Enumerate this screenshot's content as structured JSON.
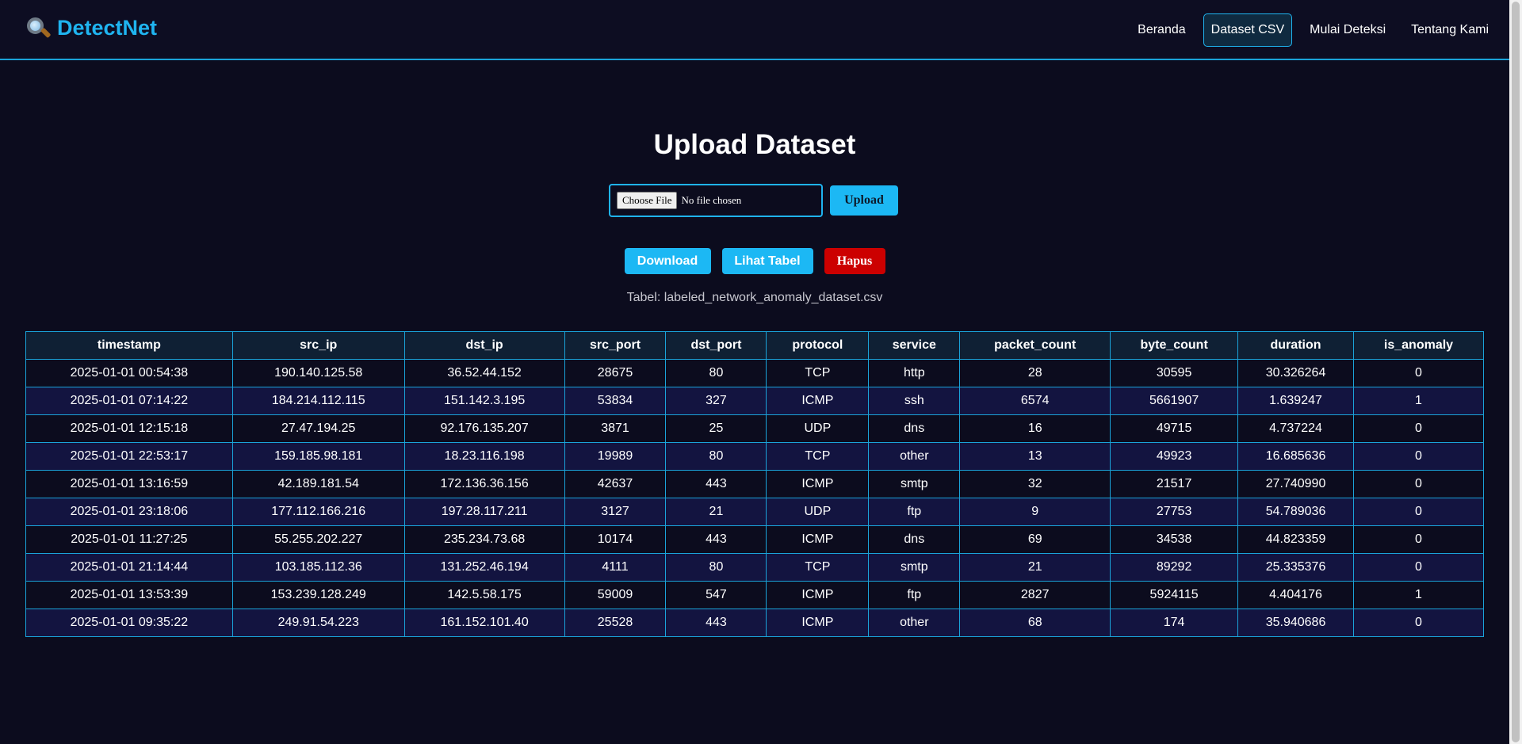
{
  "navbar": {
    "brand": "DetectNet",
    "links": [
      "Beranda",
      "Dataset CSV",
      "Mulai Deteksi",
      "Tentang Kami"
    ],
    "active_index": 1
  },
  "upload": {
    "title": "Upload Dataset",
    "choose_file_label": "Choose File",
    "file_status": "No file chosen",
    "upload_label": "Upload"
  },
  "actions": {
    "download_label": "Download",
    "view_label": "Lihat Tabel",
    "delete_label": "Hapus"
  },
  "caption": "Tabel: labeled_network_anomaly_dataset.csv",
  "table": {
    "columns": [
      "timestamp",
      "src_ip",
      "dst_ip",
      "src_port",
      "dst_port",
      "protocol",
      "service",
      "packet_count",
      "byte_count",
      "duration",
      "is_anomaly"
    ],
    "rows": [
      [
        "2025-01-01 00:54:38",
        "190.140.125.58",
        "36.52.44.152",
        "28675",
        "80",
        "TCP",
        "http",
        "28",
        "30595",
        "30.326264",
        "0"
      ],
      [
        "2025-01-01 07:14:22",
        "184.214.112.115",
        "151.142.3.195",
        "53834",
        "327",
        "ICMP",
        "ssh",
        "6574",
        "5661907",
        "1.639247",
        "1"
      ],
      [
        "2025-01-01 12:15:18",
        "27.47.194.25",
        "92.176.135.207",
        "3871",
        "25",
        "UDP",
        "dns",
        "16",
        "49715",
        "4.737224",
        "0"
      ],
      [
        "2025-01-01 22:53:17",
        "159.185.98.181",
        "18.23.116.198",
        "19989",
        "80",
        "TCP",
        "other",
        "13",
        "49923",
        "16.685636",
        "0"
      ],
      [
        "2025-01-01 13:16:59",
        "42.189.181.54",
        "172.136.36.156",
        "42637",
        "443",
        "ICMP",
        "smtp",
        "32",
        "21517",
        "27.740990",
        "0"
      ],
      [
        "2025-01-01 23:18:06",
        "177.112.166.216",
        "197.28.117.211",
        "3127",
        "21",
        "UDP",
        "ftp",
        "9",
        "27753",
        "54.789036",
        "0"
      ],
      [
        "2025-01-01 11:27:25",
        "55.255.202.227",
        "235.234.73.68",
        "10174",
        "443",
        "ICMP",
        "dns",
        "69",
        "34538",
        "44.823359",
        "0"
      ],
      [
        "2025-01-01 21:14:44",
        "103.185.112.36",
        "131.252.46.194",
        "4111",
        "80",
        "TCP",
        "smtp",
        "21",
        "89292",
        "25.335376",
        "0"
      ],
      [
        "2025-01-01 13:53:39",
        "153.239.128.249",
        "142.5.58.175",
        "59009",
        "547",
        "ICMP",
        "ftp",
        "2827",
        "5924115",
        "4.404176",
        "1"
      ],
      [
        "2025-01-01 09:35:22",
        "249.91.54.223",
        "161.152.101.40",
        "25528",
        "443",
        "ICMP",
        "other",
        "68",
        "174",
        "35.940686",
        "0"
      ]
    ]
  },
  "colors": {
    "background": "#0c0c1e",
    "accent": "#1cb8f4",
    "danger": "#cc0000"
  }
}
